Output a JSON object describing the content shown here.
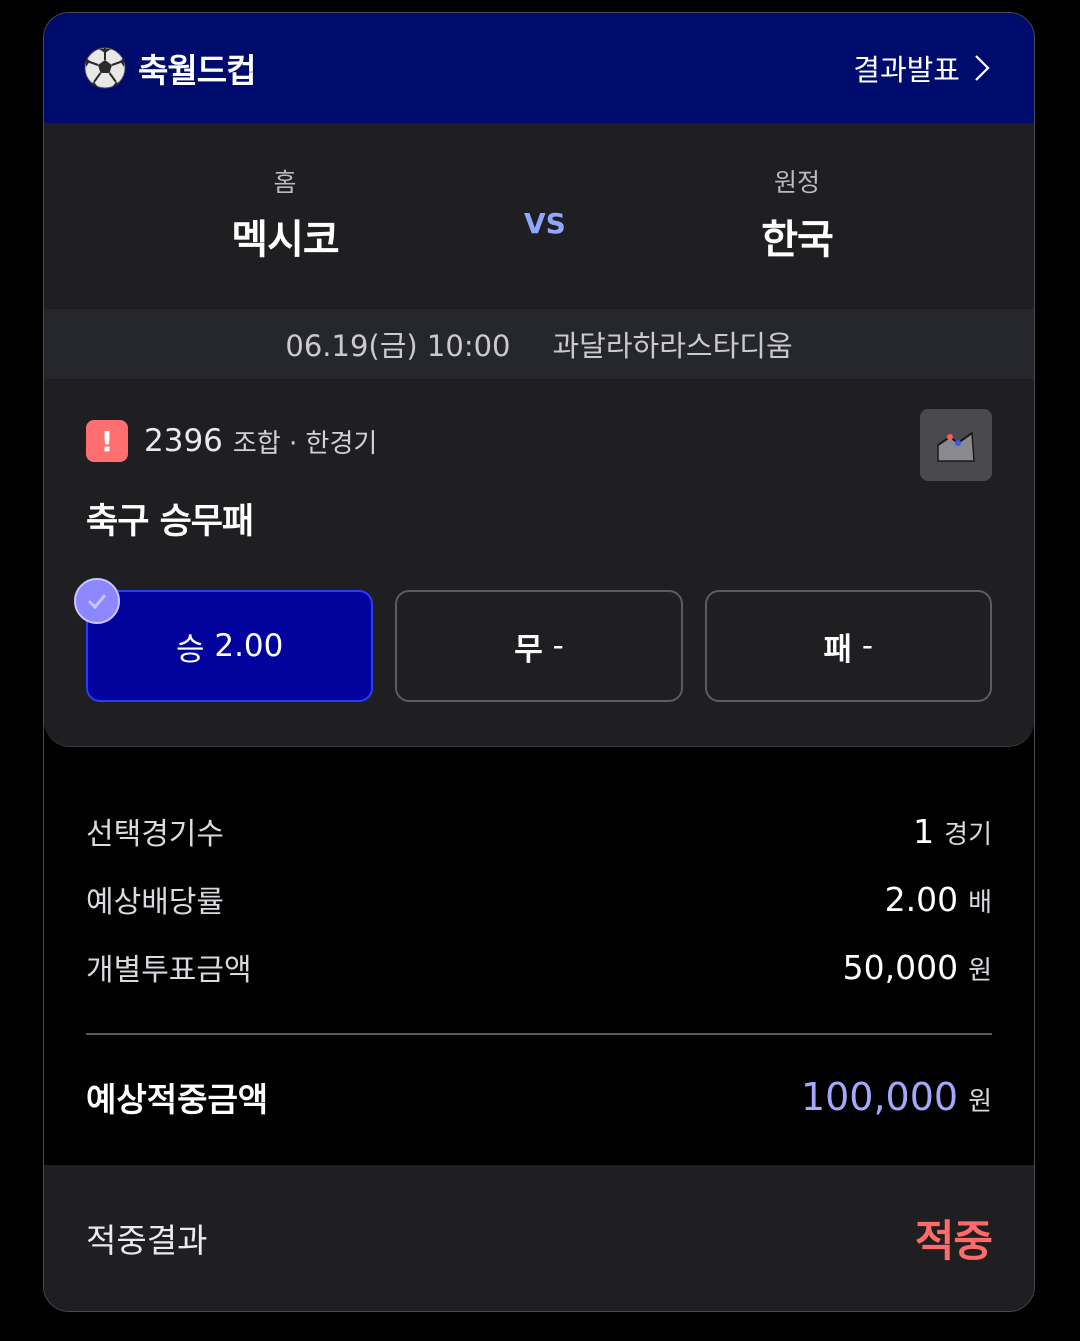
{
  "header": {
    "title": "축월드컵",
    "results_link": "결과발표",
    "icons": {
      "ball": "soccer-ball-icon",
      "chevron": "chevron-right-icon"
    }
  },
  "match": {
    "home_label": "홈",
    "home_team": "멕시코",
    "vs": "VS",
    "away_label": "원정",
    "away_team": "한국",
    "datetime": "06.19(금) 10:00",
    "venue": "과달라하라스타디움"
  },
  "bet": {
    "number": "2396",
    "tag": "조합 · 한경기",
    "title": "축구 승무패",
    "warn_symbol": "!",
    "options": [
      {
        "label": "승",
        "odds": "2.00",
        "selected": true
      },
      {
        "label": "무",
        "odds": "-",
        "selected": false
      },
      {
        "label": "패",
        "odds": "-",
        "selected": false
      }
    ]
  },
  "summary": {
    "rows": [
      {
        "key": "선택경기수",
        "value": "1",
        "unit": "경기"
      },
      {
        "key": "예상배당률",
        "value": "2.00",
        "unit": "배"
      },
      {
        "key": "개별투표금액",
        "value": "50,000",
        "unit": "원"
      }
    ],
    "total": {
      "key": "예상적중금액",
      "value": "100,000",
      "unit": "원"
    }
  },
  "result": {
    "key": "적중결과",
    "value": "적중"
  },
  "colors": {
    "header_bg": "#000b6e",
    "selected_bg": "#02029c",
    "accent_total": "#a6a8ff",
    "hit_red": "#ff6b6b"
  }
}
